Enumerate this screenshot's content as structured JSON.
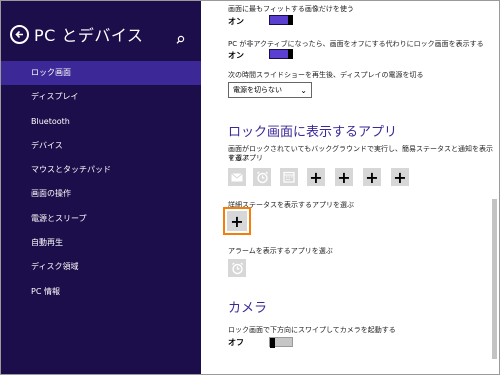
{
  "sidebar": {
    "title": "PC とデバイス",
    "items": [
      {
        "label": "ロック画面",
        "active": true
      },
      {
        "label": "ディスプレイ"
      },
      {
        "label": "Bluetooth"
      },
      {
        "label": "デバイス"
      },
      {
        "label": "マウスとタッチパッド"
      },
      {
        "label": "画面の操作"
      },
      {
        "label": "電源とスリープ"
      },
      {
        "label": "自動再生"
      },
      {
        "label": "ディスク領域"
      },
      {
        "label": "PC 情報"
      }
    ]
  },
  "content": {
    "fit_image_label": "画面に最もフィットする画像だけを使う",
    "fit_image_state": "オン",
    "inactive_label": "PC が非アクティブになったら、画面をオフにする代わりにロック画面を表示する",
    "inactive_state": "オン",
    "slideshow_label": "次の時間スライドショーを再生後、ディスプレイの電源を切る",
    "slideshow_value": "電源を切らない",
    "apps_heading": "ロック画面に表示するアプリ",
    "apps_desc_line1": "画面がロックされていてもバックグラウンドで実行し、簡易ステータスと通知を表示するアプリ",
    "apps_desc_line2": "を選ぶ",
    "detail_label": "詳細ステータスを表示するアプリを選ぶ",
    "alarm_label": "アラームを表示するアプリを選ぶ",
    "camera_heading": "カメラ",
    "camera_label": "ロック画面で下方向にスワイプしてカメラを起動する",
    "camera_state": "オフ"
  },
  "colors": {
    "sidebar_bg": "#1c0e4a",
    "sidebar_active": "#3d2897",
    "accent": "#5a3fd0",
    "heading": "#3d2897",
    "highlight": "#f57e0a"
  }
}
